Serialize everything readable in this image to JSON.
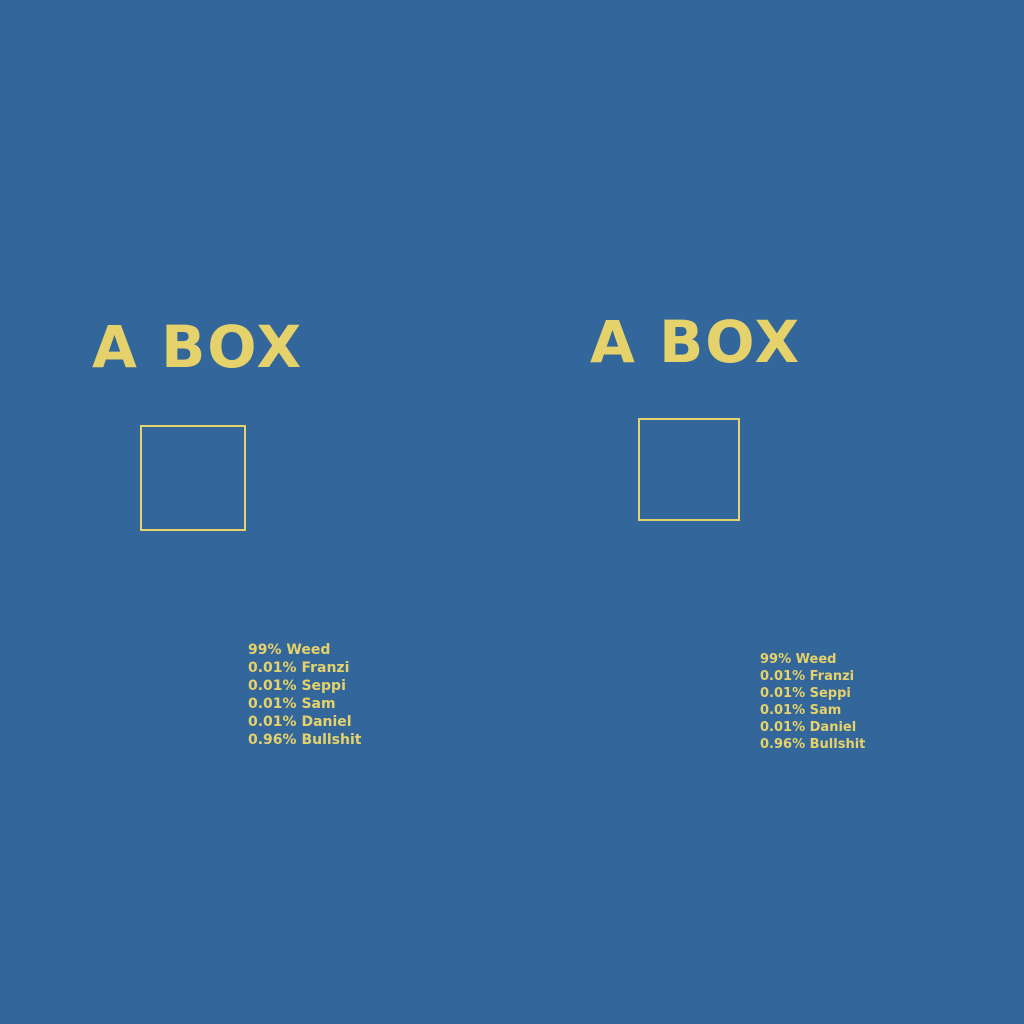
{
  "colors": {
    "background": "#33669a",
    "accent": "#e6d26a"
  },
  "panels": [
    {
      "title": "A BOX",
      "items": [
        "99% Weed",
        "0.01% Franzi",
        "0.01% Seppi",
        "0.01% Sam",
        "0.01% Daniel",
        "0.96% Bullshit"
      ]
    },
    {
      "title": "A BOX",
      "items": [
        "99% Weed",
        "0.01% Franzi",
        "0.01% Seppi",
        "0.01% Sam",
        "0.01% Daniel",
        "0.96% Bullshit"
      ]
    }
  ]
}
